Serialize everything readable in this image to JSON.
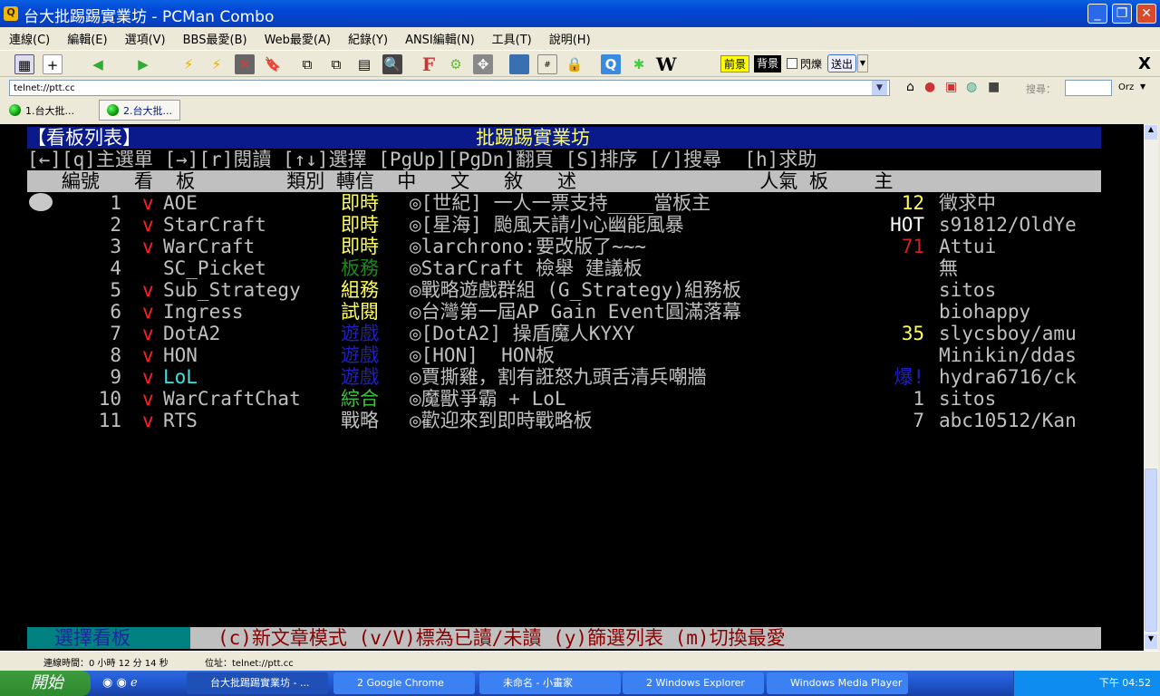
{
  "window": {
    "title": "台大批踢踢實業坊 - PCMan Combo",
    "min": "_",
    "max": "❐",
    "close": "✕"
  },
  "menu": [
    "連線(C)",
    "編輯(E)",
    "選項(V)",
    "BBS最愛(B)",
    "Web最愛(A)",
    "紀錄(Y)",
    "ANSI編輯(N)",
    "工具(T)",
    "說明(H)"
  ],
  "toolbar": {
    "fg": "前景",
    "bg": "背景",
    "blink": "閃爍",
    "send": "送出",
    "close": "X"
  },
  "address": {
    "value": "telnet://ptt.cc",
    "search_label": "搜尋：",
    "search_engine": "Orz"
  },
  "tabs": [
    "1.台大批...",
    "2.台大批..."
  ],
  "term": {
    "header_left": "【看板列表】",
    "header_center": "批踢踢實業坊",
    "help": "[←][q]主選單 [→][r]閱讀 [↑↓]選擇 [PgUp][PgDn]翻頁 [S]排序 [/]搜尋  [h]求助",
    "col_header": "   編號   看  板        類別 轉信  中   文   敘   述                人氣 板    主",
    "rows": [
      {
        "num": "1",
        "check": "v",
        "board": "AOE",
        "cat": "即時",
        "catc": "#ffff55",
        "desc": "◎[世紀] 一人一票支持____當板主",
        "pop": "12",
        "popc": "#ffff55",
        "mod": "徵求中",
        "bc": "#c0c0c0"
      },
      {
        "num": "2",
        "check": "v",
        "board": "StarCraft",
        "cat": "即時",
        "catc": "#ffff55",
        "desc": "◎[星海] 颱風天請小心幽能風暴",
        "pop": "HOT",
        "popc": "#ffffff",
        "mod": "s91812/OldYe",
        "bc": "#c0c0c0"
      },
      {
        "num": "3",
        "check": "v",
        "board": "WarCraft",
        "cat": "即時",
        "catc": "#ffff55",
        "desc": "◎larchrono:要改版了~~~",
        "pop": "71",
        "popc": "#d02020",
        "mod": "Attui",
        "bc": "#c0c0c0"
      },
      {
        "num": "4",
        "check": "",
        "board": "SC_Picket",
        "cat": "板務",
        "catc": "#1a8a1a",
        "desc": "◎StarCraft 檢舉 建議板",
        "pop": "",
        "popc": "#c0c0c0",
        "mod": "無",
        "bc": "#c0c0c0"
      },
      {
        "num": "5",
        "check": "v",
        "board": "Sub_Strategy",
        "cat": "組務",
        "catc": "#ffff55",
        "desc": "◎戰略遊戲群組 (G_Strategy)組務板",
        "pop": "",
        "popc": "#c0c0c0",
        "mod": "sitos",
        "bc": "#c0c0c0"
      },
      {
        "num": "6",
        "check": "v",
        "board": "Ingress",
        "cat": "試閱",
        "catc": "#ffff55",
        "desc": "◎台灣第一屆AP Gain Event圓滿落幕",
        "pop": "",
        "popc": "#c0c0c0",
        "mod": "biohappy",
        "bc": "#c0c0c0"
      },
      {
        "num": "7",
        "check": "v",
        "board": "DotA2",
        "cat": "遊戲",
        "catc": "#2020c0",
        "desc": "◎[DotA2] 操盾魔人KYXY",
        "pop": "35",
        "popc": "#ffff55",
        "mod": "slycsboy/amu",
        "bc": "#c0c0c0"
      },
      {
        "num": "8",
        "check": "v",
        "board": "HON",
        "cat": "遊戲",
        "catc": "#2020c0",
        "desc": "◎[HON]  HON板",
        "pop": "",
        "popc": "#c0c0c0",
        "mod": "Minikin/ddas",
        "bc": "#c0c0c0"
      },
      {
        "num": "9",
        "check": "v",
        "board": "LoL",
        "cat": "遊戲",
        "catc": "#2020c0",
        "desc": "◎賈撕雞，割有誑怒九頭舌清兵嘲牆",
        "pop": "爆!",
        "popc": "#2020c0",
        "mod": "hydra6716/ck",
        "bc": "#40e0e0"
      },
      {
        "num": "10",
        "check": "v",
        "board": "WarCraftChat",
        "cat": "綜合",
        "catc": "#40c040",
        "desc": "◎魔獸爭霸 + LoL",
        "pop": "1",
        "popc": "#c0c0c0",
        "mod": "sitos",
        "bc": "#c0c0c0"
      },
      {
        "num": "11",
        "check": "v",
        "board": "RTS",
        "cat": "戰略",
        "catc": "#c0c0c0",
        "desc": "◎歡迎來到即時戰略板",
        "pop": "7",
        "popc": "#c0c0c0",
        "mod": "abc10512/Kan",
        "bc": "#c0c0c0"
      }
    ],
    "footer_left": "選擇看板",
    "footer_right": "(c)新文章模式 (v/V)標為已讀/未讀 (y)篩選列表 (m)切換最愛"
  },
  "status": {
    "conn_time": "連線時間：0 小時 12 分 14 秒",
    "address": "位址：telnet://ptt.cc"
  },
  "taskbar": {
    "start": "開始",
    "tasks": [
      "台大批踢踢實業坊 - ...",
      "2 Google Chrome",
      "未命名 - 小畫家",
      "2 Windows Explorer",
      "Windows Media Player"
    ],
    "time": "下午 04:52"
  }
}
